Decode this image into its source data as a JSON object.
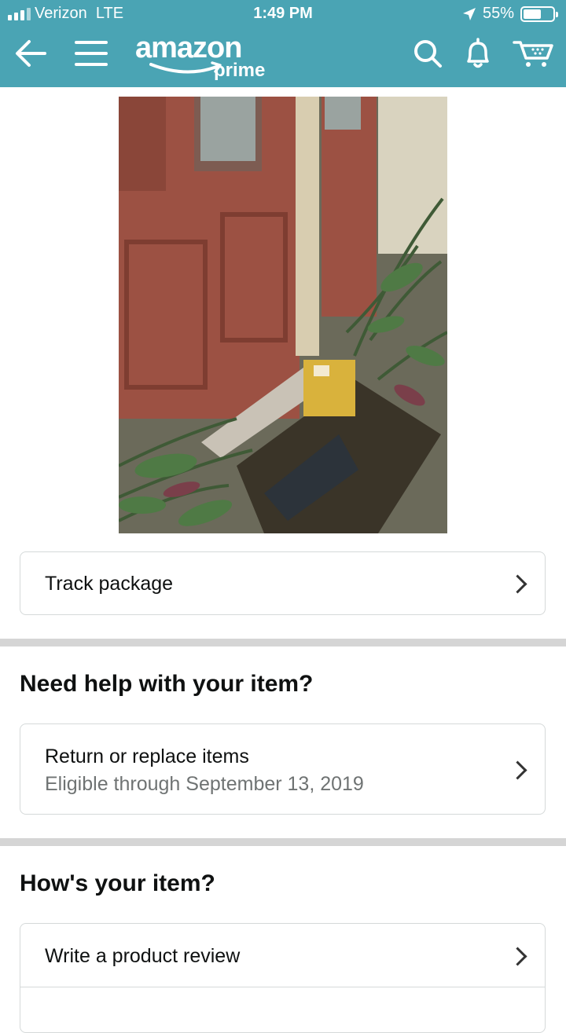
{
  "status_bar": {
    "carrier": "Verizon",
    "network": "LTE",
    "time": "1:49 PM",
    "battery": "55%"
  },
  "nav": {
    "icons": [
      "back-arrow-icon",
      "menu-icon",
      "search-icon",
      "bell-icon",
      "cart-icon"
    ],
    "logo_word": "amazon",
    "logo_sub": "prime"
  },
  "colors": {
    "header_bg": "#4aa4b4",
    "divider": "#d5d5d5",
    "secondary_text": "#6f7373"
  },
  "track": {
    "label": "Track package"
  },
  "help_section": {
    "heading": "Need help with your item?",
    "return_title": "Return or replace items",
    "return_sub": "Eligible through September 13, 2019"
  },
  "review_section": {
    "heading": "How's your item?",
    "review_label": "Write a product review"
  }
}
